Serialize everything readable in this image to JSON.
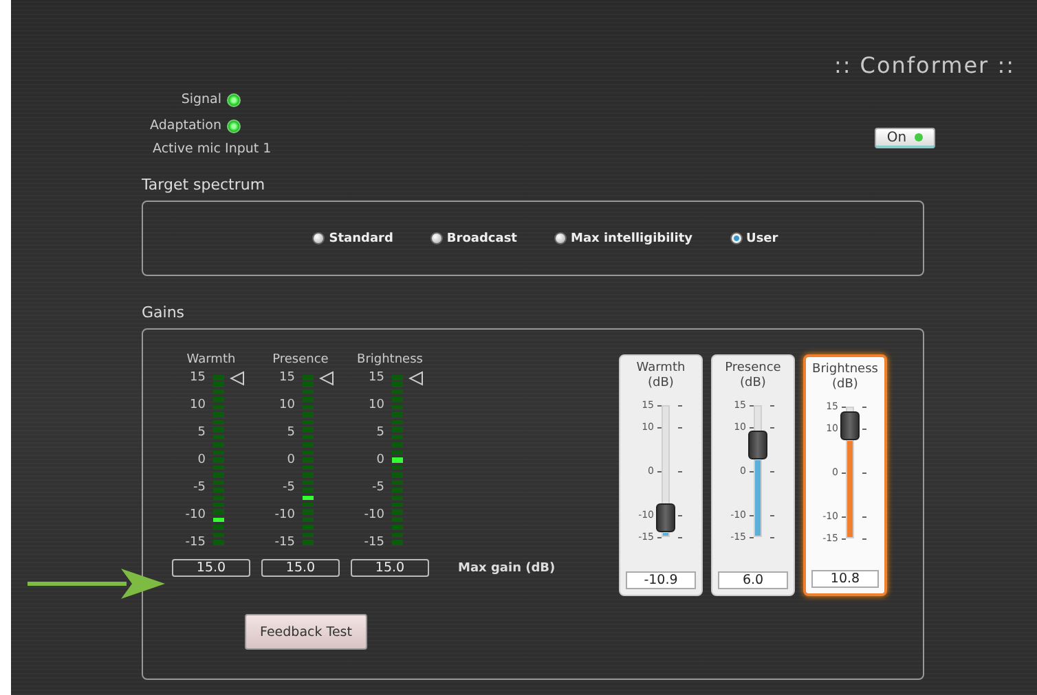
{
  "title": ":: Conformer ::",
  "status": [
    {
      "label": "Signal",
      "on": true
    },
    {
      "label": "Adaptation",
      "on": true
    }
  ],
  "active_mic": "Active mic Input 1",
  "power_button": {
    "label": "On",
    "on": true
  },
  "target_spectrum": {
    "title": "Target spectrum",
    "options": [
      {
        "label": "Standard",
        "selected": false
      },
      {
        "label": "Broadcast",
        "selected": false
      },
      {
        "label": "Max intelligibility",
        "selected": false
      },
      {
        "label": "User",
        "selected": true
      }
    ]
  },
  "gains": {
    "title": "Gains",
    "meters": [
      {
        "label": "Warmth",
        "ticks": [
          "15",
          "10",
          "5",
          "0",
          "-5",
          "-10",
          "-15"
        ],
        "level": 0.12,
        "max_gain": "15.0"
      },
      {
        "label": "Presence",
        "ticks": [
          "15",
          "10",
          "5",
          "0",
          "-5",
          "-10",
          "-15"
        ],
        "level": 0.29,
        "max_gain": "15.0"
      },
      {
        "label": "Brightness",
        "ticks": [
          "15",
          "10",
          "5",
          "0",
          "-5",
          "-10",
          "-15"
        ],
        "level": 0.5,
        "max_gain": "15.0"
      }
    ],
    "max_gain_label": "Max gain (dB)",
    "feedback_button": "Feedback Test",
    "sliders": [
      {
        "label": "Warmth",
        "unit": "(dB)",
        "ticks": [
          "15",
          "10",
          "0",
          "-10",
          "-15"
        ],
        "level": 0.137,
        "value": "-10.9",
        "selected": false
      },
      {
        "label": "Presence",
        "unit": "(dB)",
        "ticks": [
          "15",
          "10",
          "0",
          "-10",
          "-15"
        ],
        "level": 0.7,
        "value": "6.0",
        "selected": false
      },
      {
        "label": "Brightness",
        "unit": "(dB)",
        "ticks": [
          "15",
          "10",
          "0",
          "-10",
          "-15"
        ],
        "level": 0.86,
        "value": "10.8",
        "selected": true
      }
    ]
  }
}
